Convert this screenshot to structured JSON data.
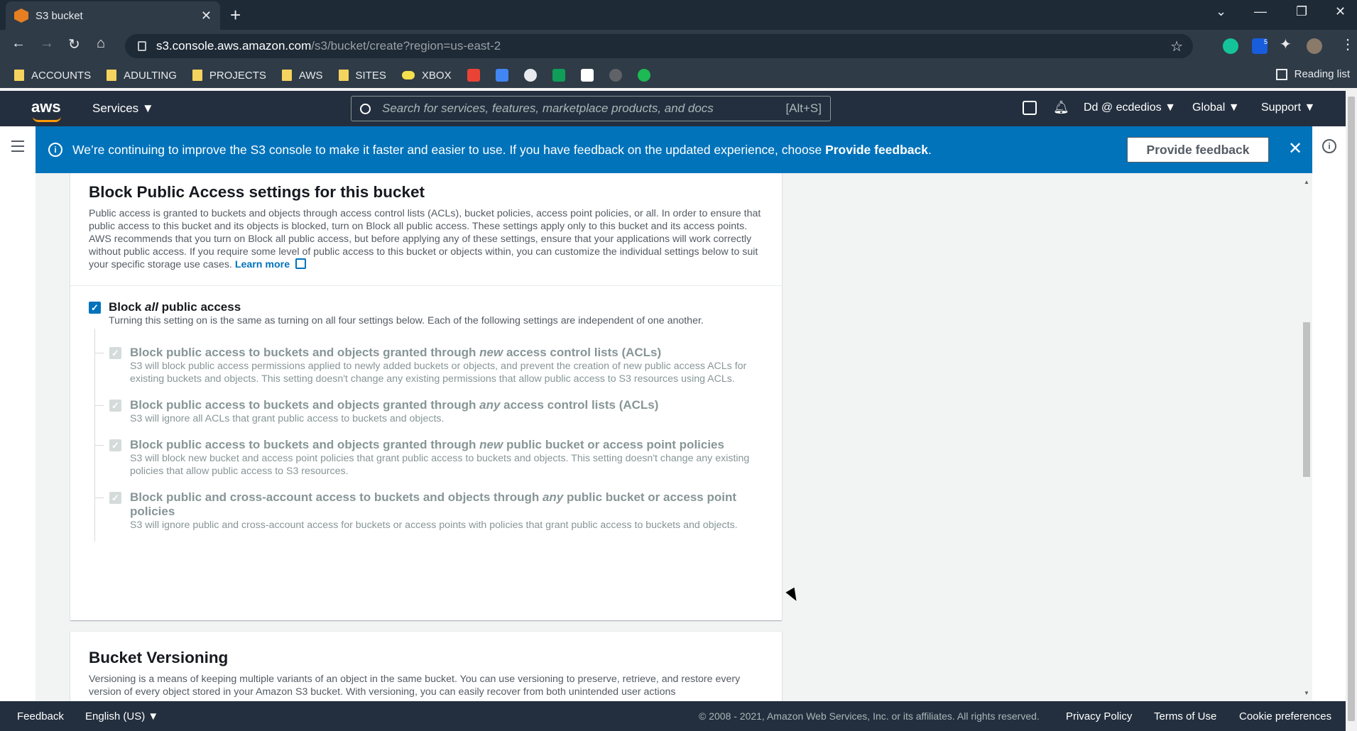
{
  "browser": {
    "tab_title": "S3 bucket",
    "url_host": "s3.console.aws.amazon.com",
    "url_path": "/s3/bucket/create?region=us-east-2",
    "extension_badge": "5",
    "reading_list": "Reading list",
    "bookmarks": [
      "ACCOUNTS",
      "ADULTING",
      "PROJECTS",
      "AWS",
      "SITES",
      "XBOX"
    ]
  },
  "awsnav": {
    "logo": "aws",
    "services": "Services ▼",
    "search_placeholder": "Search for services, features, marketplace products, and docs",
    "search_hint": "[Alt+S]",
    "account": "Dd @ ecdedios ▼",
    "region": "Global ▼",
    "support": "Support ▼"
  },
  "flash": {
    "message": "We’re continuing to improve the S3 console to make it faster and easier to use. If you have feedback on the updated experience, choose ",
    "message_bold": "Provide feedback",
    "message_end": ".",
    "button": "Provide feedback"
  },
  "block_public": {
    "title": "Block Public Access settings for this bucket",
    "description": "Public access is granted to buckets and objects through access control lists (ACLs), bucket policies, access point policies, or all. In order to ensure that public access to this bucket and its objects is blocked, turn on Block all public access. These settings apply only to this bucket and its access points. AWS recommends that you turn on Block all public access, but before applying any of these settings, ensure that your applications will work correctly without public access. If you require some level of public access to this bucket or objects within, you can customize the individual settings below to suit your specific storage use cases.",
    "learn_more": "Learn more",
    "main_option": {
      "title_pre": "Block ",
      "title_em": "all",
      "title_post": " public access",
      "desc": "Turning this setting on is the same as turning on all four settings below. Each of the following settings are independent of one another.",
      "checked": true
    },
    "sub_options": [
      {
        "title_pre": "Block public access to buckets and objects granted through ",
        "title_em": "new",
        "title_post": " access control lists (ACLs)",
        "desc": "S3 will block public access permissions applied to newly added buckets or objects, and prevent the creation of new public access ACLs for existing buckets and objects. This setting doesn't change any existing permissions that allow public access to S3 resources using ACLs."
      },
      {
        "title_pre": "Block public access to buckets and objects granted through ",
        "title_em": "any",
        "title_post": " access control lists (ACLs)",
        "desc": "S3 will ignore all ACLs that grant public access to buckets and objects."
      },
      {
        "title_pre": "Block public access to buckets and objects granted through ",
        "title_em": "new",
        "title_post": " public bucket or access point policies",
        "desc": "S3 will block new bucket and access point policies that grant public access to buckets and objects. This setting doesn't change any existing policies that allow public access to S3 resources."
      },
      {
        "title_pre": "Block public and cross-account access to buckets and objects through ",
        "title_em": "any",
        "title_post": " public bucket or access point policies",
        "desc": "S3 will ignore public and cross-account access for buckets or access points with policies that grant public access to buckets and objects."
      }
    ]
  },
  "versioning": {
    "title": "Bucket Versioning",
    "description": "Versioning is a means of keeping multiple variants of an object in the same bucket. You can use versioning to preserve, retrieve, and restore every version of every object stored in your Amazon S3 bucket. With versioning, you can easily recover from both unintended user actions"
  },
  "footer": {
    "feedback": "Feedback",
    "language": "English (US) ▼",
    "copyright": "© 2008 - 2021, Amazon Web Services, Inc. or its affiliates. All rights reserved.",
    "privacy": "Privacy Policy",
    "terms": "Terms of Use",
    "cookies": "Cookie preferences"
  },
  "colors": {
    "accent": "#0073bb",
    "aws_orange": "#ff9900",
    "nav_bg": "#232f3e"
  }
}
